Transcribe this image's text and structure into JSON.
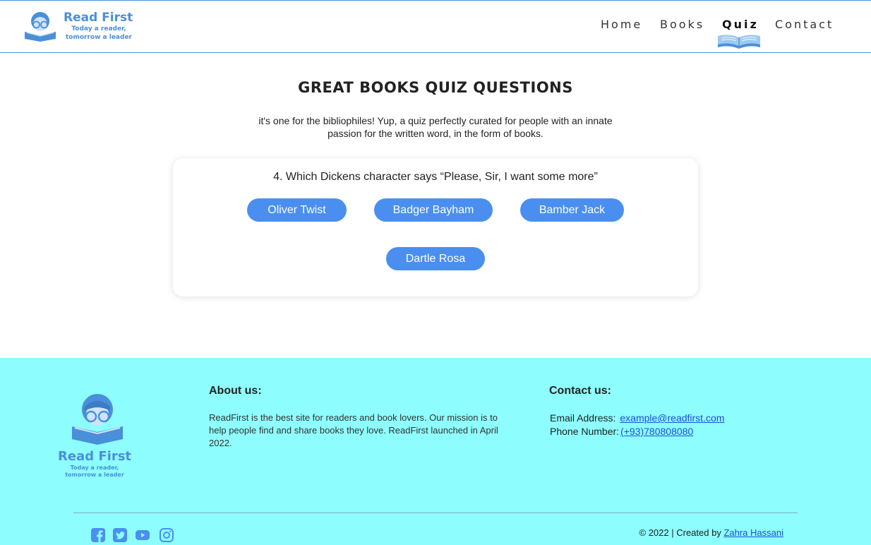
{
  "brand": {
    "name": "Read First",
    "tagline_line1": "Today a reader,",
    "tagline_line2": "tomorrow a leader",
    "color": "#4a8fd9"
  },
  "nav": {
    "items": [
      {
        "label": "Home",
        "active": false
      },
      {
        "label": "Books",
        "active": false
      },
      {
        "label": "Quiz",
        "active": true
      },
      {
        "label": "Contact",
        "active": false
      }
    ]
  },
  "hero": {
    "title": "GREAT BOOKS QUIZ QUESTIONS",
    "intro": "it's one for the bibliophiles! Yup, a quiz perfectly curated for people with an innate passion for the written word, in the form of books."
  },
  "quiz": {
    "question": "4. Which Dickens character says “Please, Sir, I want some more”",
    "answers": [
      "Oliver Twist",
      "Badger Bayham",
      "Bamber Jack",
      "Dartle Rosa"
    ],
    "button_color": "#4a8ff0"
  },
  "footer": {
    "background": "#8dfdfd",
    "logo_name": "Read First",
    "logo_tagline_line1": "Today a reader,",
    "logo_tagline_line2": "tomorrow a leader",
    "about": {
      "heading": "About us:",
      "text": "ReadFirst is the best site for readers and book lovers. Our mission is to help people find and share books they love. ReadFirst launched in April 2022."
    },
    "contact": {
      "heading": "Contact us:",
      "email_label": "Email Address:",
      "email": "example@readfirst.com",
      "phone_label": "Phone Number:",
      "phone": "(+93)780808080"
    },
    "socials": [
      {
        "icon": "facebook-icon"
      },
      {
        "icon": "twitter-icon"
      },
      {
        "icon": "youtube-icon"
      },
      {
        "icon": "instagram-icon"
      }
    ],
    "copyright_text": "© 2022 | Created by",
    "author": "Zahra Hassani"
  }
}
